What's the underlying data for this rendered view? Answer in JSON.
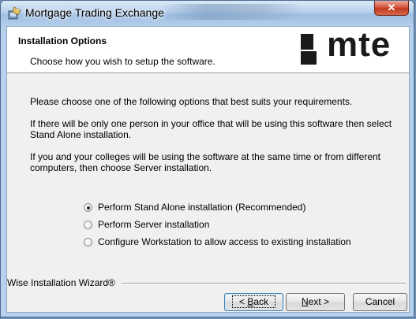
{
  "window": {
    "title": "Mortgage Trading Exchange",
    "close_glyph": "✕"
  },
  "header": {
    "title": "Installation Options",
    "subtitle": "Choose how you wish to setup the software.",
    "logo_text": "mte"
  },
  "body": {
    "intro": "Please choose one of the following options that best suits your requirements.",
    "standalone_note": "If there will be only one person in your office that will be using this software then select Stand Alone installation.",
    "server_note": "If you and your colleges will be using the software at the same time or from different computers, then choose Server installation."
  },
  "options": [
    {
      "label": "Perform Stand Alone installation (Recommended)",
      "checked": true
    },
    {
      "label": "Perform Server installation",
      "checked": false
    },
    {
      "label": "Configure Workstation to allow access to existing installation",
      "checked": false
    }
  ],
  "footer": {
    "brand": "Wise Installation Wizard®",
    "back": {
      "mnemonic": "B",
      "rest": "ack",
      "prefix": "< "
    },
    "next": {
      "mnemonic": "N",
      "rest": "ext >"
    },
    "cancel": "Cancel"
  },
  "colors": {
    "window_frame": "#a9c6e6",
    "close_button": "#c23a1f",
    "dialog_bg": "#f0f0f0",
    "header_bg": "#ffffff",
    "logo": "#1a1a1a"
  }
}
